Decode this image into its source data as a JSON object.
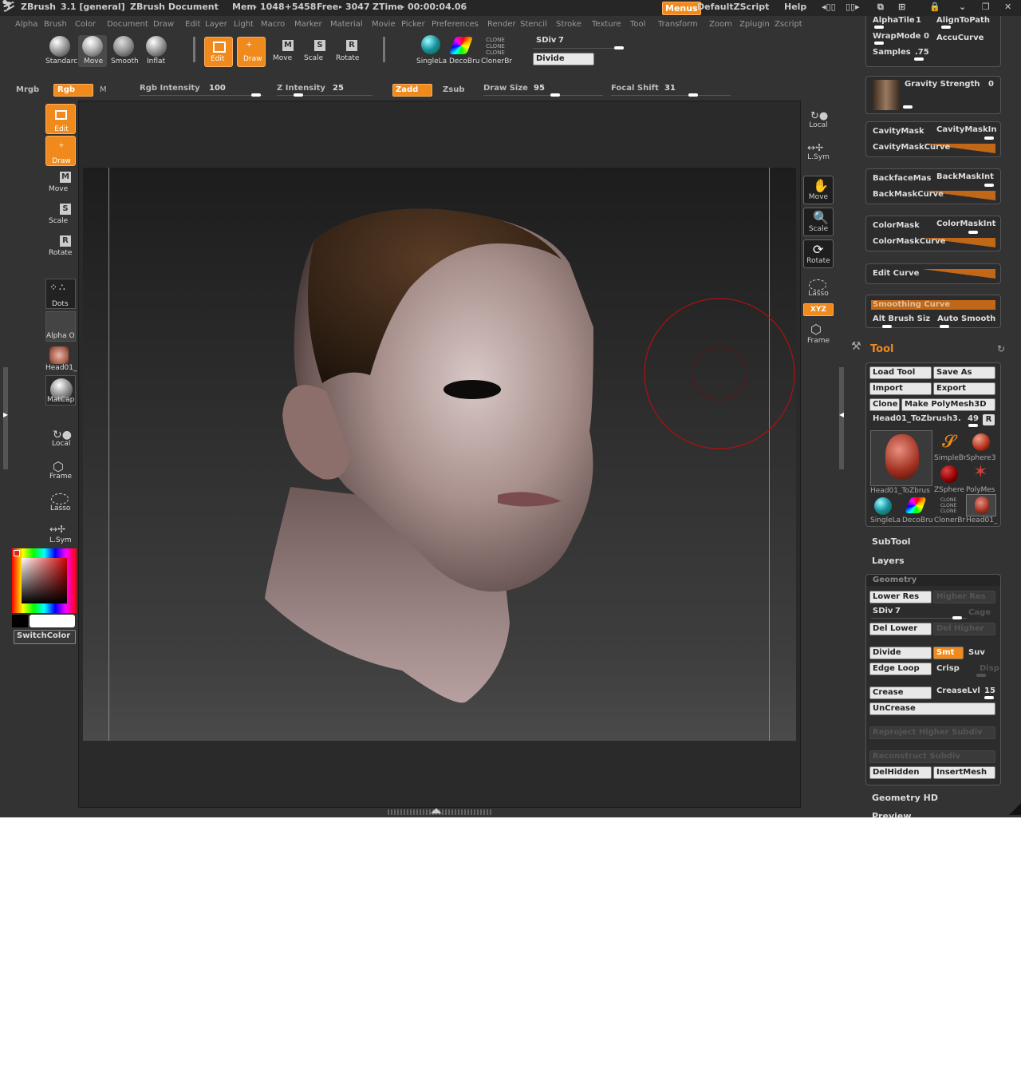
{
  "titlebar": {
    "app": "ZBrush",
    "version": "3.1 [general]",
    "doc": "ZBrush Document",
    "mem_label": "Mem",
    "mem_value": "1048+5458",
    "free_label": "Free",
    "free_value": "3047",
    "ztime_label": "ZTime",
    "ztime_value": "00:00:04.06",
    "menus_btn": "Menus",
    "script": "DefaultZScript",
    "help": "Help"
  },
  "menubar": [
    "Alpha",
    "Brush",
    "Color",
    "Document",
    "Draw",
    "Edit",
    "Layer",
    "Light",
    "Macro",
    "Marker",
    "Material",
    "Movie",
    "Picker",
    "Preferences",
    "Render",
    "Stencil",
    "Stroke",
    "Texture",
    "Tool",
    "Transform",
    "Zoom",
    "Zplugin",
    "Zscript"
  ],
  "shelf": {
    "brushes": [
      "Standarc",
      "Move",
      "Smooth",
      "Inflat"
    ],
    "edit": "Edit",
    "draw": "Draw",
    "move": "Move",
    "scale": "Scale",
    "rotate": "Rotate",
    "mode_letters": {
      "move": "M",
      "scale": "S",
      "rotate": "R"
    },
    "recent": [
      "SingleLa",
      "DecoBru",
      "ClonerBr"
    ],
    "clone_text": "CLONE",
    "sdiv_label": "SDiv",
    "sdiv_value": "7",
    "sdiv_fraction": 1.0,
    "divide": "Divide"
  },
  "drawbar": {
    "mrgb": "Mrgb",
    "rgb": "Rgb",
    "m": "M",
    "rgb_int_label": "Rgb  Intensity",
    "rgb_int_value": "100",
    "z_int_label": "Z  Intensity",
    "z_int_value": "25",
    "zadd": "Zadd",
    "zsub": "Zsub",
    "draw_size_label": "Draw  Size",
    "draw_size_value": "95",
    "focal_label": "Focal  Shift",
    "focal_value": "31"
  },
  "lefttray": {
    "edit": "Edit",
    "draw": "Draw",
    "move": "Move",
    "scale": "Scale",
    "rotate": "Rotate",
    "dots": "Dots",
    "alpha": "Alpha  O",
    "texture": "Head01_",
    "matcap": "MatCap",
    "local": "Local",
    "frame": "Frame",
    "lasso": "Lasso",
    "lsym": "L.Sym",
    "switchcolor": "SwitchColor"
  },
  "righttools": {
    "local": "Local",
    "lsym": "L.Sym",
    "move": "Move",
    "scale": "Scale",
    "rotate": "Rotate",
    "lasso": "Lasso",
    "xyz": "XYZ",
    "frame": "Frame"
  },
  "rpanel": {
    "alphatile_label": "AlphaTile",
    "alphatile_value": "1",
    "aligntopath": "AlignToPath",
    "wrapmode_label": "WrapMode",
    "wrapmode_value": "0",
    "accucurve": "AccuCurve",
    "samples_label": "Samples",
    "samples_value": ".75",
    "gravity_label": "Gravity Strength",
    "gravity_value": "0",
    "cavitymask": "CavityMask",
    "cavitymaskint": "CavityMaskIn",
    "cavitymaskcurve": "CavityMaskCurve",
    "backfacemask": "BackfaceMas",
    "backmaskint": "BackMaskInt",
    "backmaskcurve": "BackMaskCurve",
    "colormask": "ColorMask",
    "colormaskint": "ColorMaskInt",
    "colormaskcurve": "ColorMaskCurve",
    "editcurve": "Edit  Curve",
    "smoothingcurve": "Smoothing  Curve",
    "altbrush": "Alt  Brush  Siz",
    "autosmooth": "Auto  Smooth",
    "tool_title": "Tool",
    "load_tool": "Load  Tool",
    "save_as": "Save  As",
    "import": "Import",
    "export": "Export",
    "clone": "Clone",
    "make_polymesh": "Make  PolyMesh3D",
    "current_tool": "Head01_ToZbrush3.",
    "current_tool_value": "49",
    "r_btn": "R",
    "thumbs": [
      "Head01_ToZbrus",
      "SimpleBr",
      "Sphere3",
      "ZSphere",
      "PolyMes",
      "SingleLa",
      "DecoBru",
      "ClonerBr",
      "Head01_"
    ],
    "subtool": "SubTool",
    "layers": "Layers",
    "geometry": "Geometry",
    "lower_res": "Lower  Res",
    "higher_res": "Higher  Res",
    "sdiv_label": "SDiv",
    "sdiv_value": "7",
    "cage": "Cage",
    "del_lower": "Del  Lower",
    "del_higher": "Del  Higher",
    "divide": "Divide",
    "smt": "Smt",
    "suv": "Suv",
    "edge_loop": "Edge  Loop",
    "crisp": "Crisp",
    "disp": "Disp",
    "crease": "Crease",
    "creaselvl_label": "CreaseLvl",
    "creaselvl_value": "15",
    "uncrease": "UnCrease",
    "reproject": "Reproject  Higher  Subdiv",
    "reconstruct": "Reconstruct  Subdiv",
    "delhidden": "DelHidden",
    "insertmesh": "InsertMesh",
    "geometry_hd": "Geometry  HD",
    "preview": "Preview"
  },
  "colors": {
    "accent": "#f08a1c",
    "panel": "#333333",
    "canvas": "#2a2a2a",
    "brush_ring": "#b01010"
  }
}
